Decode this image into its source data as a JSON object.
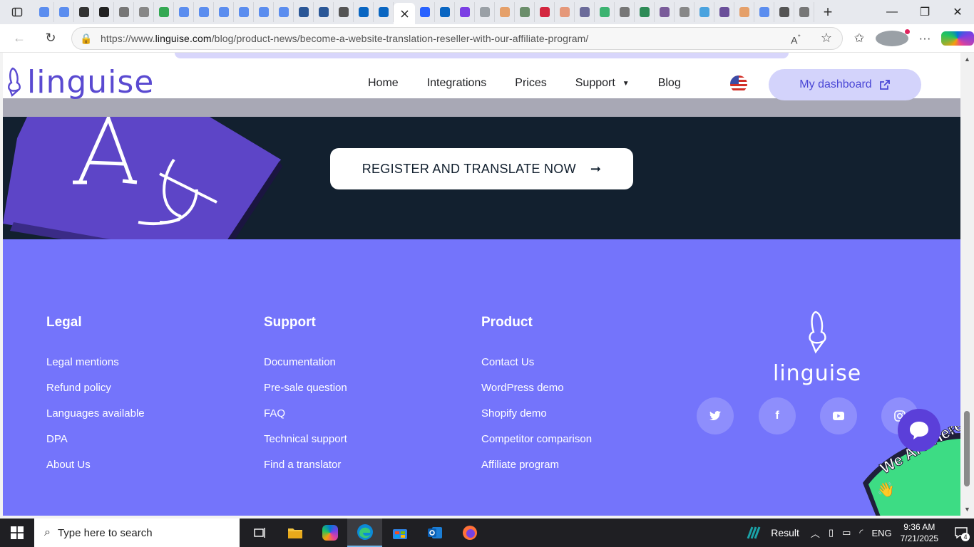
{
  "browser": {
    "tab_colors": [
      "#5b8def",
      "#5b8def",
      "#333333",
      "#222222",
      "#777777",
      "#888888",
      "#34a853",
      "#5b8def",
      "#5b8def",
      "#5b8def",
      "#5b8def",
      "#5b8def",
      "#5b8def",
      "#2b5797",
      "#2b5797",
      "#555555",
      "#0a66c2",
      "#0a66c2"
    ],
    "tabs_after": [
      "#2962ff",
      "#0a66c2",
      "#7b3fe4",
      "#9aa0a6",
      "#e5a06a",
      "#6b8e6b",
      "#d3263f",
      "#e5987a",
      "#6b6b9a",
      "#3cb371",
      "#777777",
      "#2e8b57",
      "#7a5c9a",
      "#888888",
      "#4aa3df",
      "#6a4f9a",
      "#e5a06a",
      "#5b8def",
      "#555555",
      "#777777"
    ],
    "url_prefix": "https://www.",
    "url_host": "linguise.com",
    "url_path": "/blog/product-news/become-a-website-translation-reseller-with-our-affiliate-program/"
  },
  "site": {
    "brand": "linguise",
    "nav": {
      "home": "Home",
      "integrations": "Integrations",
      "prices": "Prices",
      "support": "Support",
      "blog": "Blog"
    },
    "dashboard_label": "My dashboard",
    "cta_label": "REGISTER AND TRANSLATE NOW",
    "footer": {
      "legal": {
        "title": "Legal",
        "links": [
          "Legal mentions",
          "Refund policy",
          "Languages available",
          "DPA",
          "About Us"
        ]
      },
      "support": {
        "title": "Support",
        "links": [
          "Documentation",
          "Pre-sale question",
          "FAQ",
          "Technical support",
          "Find a translator"
        ]
      },
      "product": {
        "title": "Product",
        "links": [
          "Contact Us",
          "WordPress demo",
          "Shopify demo",
          "Competitor comparison",
          "Affiliate program"
        ]
      },
      "logo_text": "linguise",
      "chat_badge": "We Are Here!"
    },
    "colors": {
      "brand": "#5a4ad1",
      "footer": "#7474fb",
      "dark_band": "#12202f",
      "book": "#5d45c7"
    }
  },
  "taskbar": {
    "search_placeholder": "Type here to search",
    "weather_label": "Result",
    "language": "ENG",
    "time": "9:36 AM",
    "date": "7/21/2025",
    "notification_count": "4"
  }
}
